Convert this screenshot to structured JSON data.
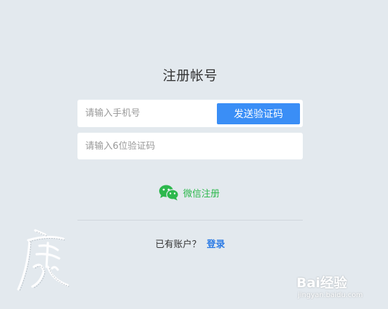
{
  "form": {
    "title": "注册帐号",
    "phone_placeholder": "请输入手机号",
    "send_code_label": "发送验证码",
    "code_placeholder": "请输入6位验证码"
  },
  "wechat": {
    "label": "微信注册",
    "icon": "wechat-icon",
    "color": "#2db84d"
  },
  "login": {
    "question": "已有账户？",
    "link_label": "登录"
  },
  "watermarks": {
    "baidu_text": "Bai经验",
    "baidu_url": "jingyan.baidu.com",
    "left_glyph": "虎"
  },
  "colors": {
    "background": "#e3e9ee",
    "accent": "#3a8ef6",
    "link": "#2c7be5"
  }
}
